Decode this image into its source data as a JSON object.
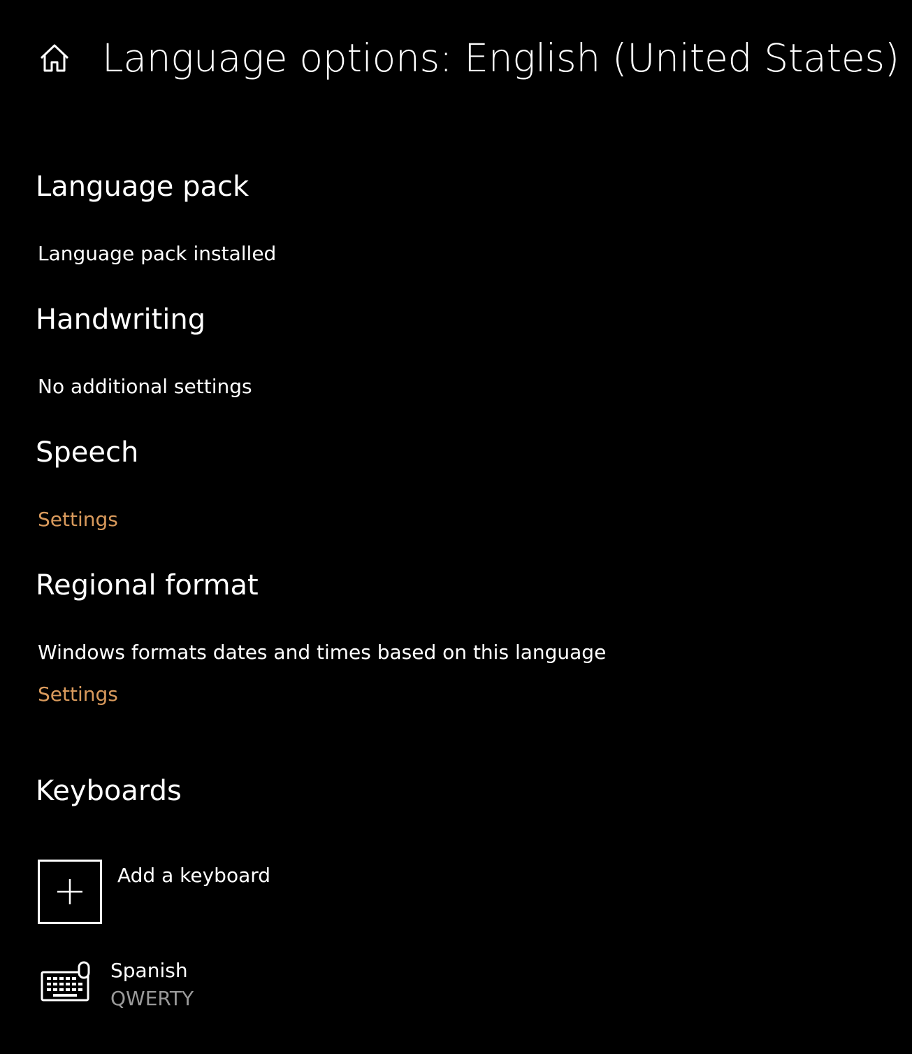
{
  "header": {
    "title": "Language options: English (United States)",
    "home_icon": "home-icon"
  },
  "sections": {
    "language_pack": {
      "heading": "Language pack",
      "status": "Language pack installed"
    },
    "handwriting": {
      "heading": "Handwriting",
      "status": "No additional settings"
    },
    "speech": {
      "heading": "Speech",
      "link": "Settings"
    },
    "regional_format": {
      "heading": "Regional format",
      "description": "Windows formats dates and times based on this language",
      "link": "Settings"
    },
    "keyboards": {
      "heading": "Keyboards",
      "add_label": "Add a keyboard",
      "items": [
        {
          "name": "Spanish",
          "layout": "QWERTY",
          "icon": "keyboard-icon"
        }
      ]
    }
  },
  "colors": {
    "background": "#000000",
    "text": "#ffffff",
    "accent_link": "#d99a5c",
    "secondary_text": "#9a9a9a"
  }
}
